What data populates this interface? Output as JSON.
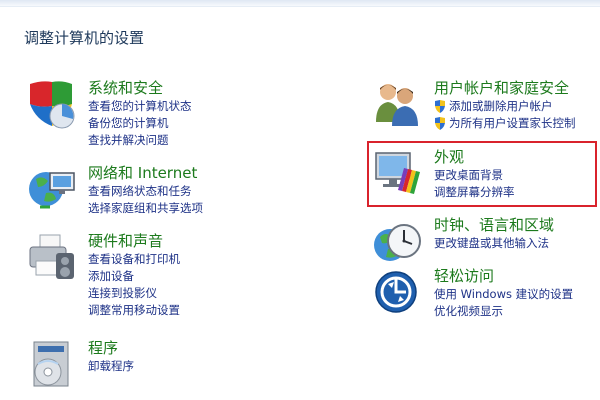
{
  "page": {
    "title": "调整计算机的设置"
  },
  "left": [
    {
      "title": "系统和安全",
      "icon": "shield-pie-icon",
      "links": [
        "查看您的计算机状态",
        "备份您的计算机",
        "查找并解决问题"
      ]
    },
    {
      "title": "网络和 Internet",
      "icon": "network-globe-icon",
      "links": [
        "查看网络状态和任务",
        "选择家庭组和共享选项"
      ]
    },
    {
      "title": "硬件和声音",
      "icon": "printer-icon",
      "links": [
        "查看设备和打印机",
        "添加设备",
        "连接到投影仪",
        "调整常用移动设置"
      ]
    },
    {
      "title": "程序",
      "icon": "programs-disc-icon",
      "links": [
        "卸载程序"
      ]
    }
  ],
  "right": [
    {
      "title": "用户帐户和家庭安全",
      "icon": "users-icon",
      "links": [
        "添加或删除用户帐户",
        "为所有用户设置家长控制"
      ],
      "link_icon": "uac-shield-icon"
    },
    {
      "title": "外观",
      "icon": "monitor-palette-icon",
      "links": [
        "更改桌面背景",
        "调整屏幕分辨率"
      ]
    },
    {
      "title": "时钟、语言和区域",
      "icon": "clock-globe-icon",
      "links": [
        "更改键盘或其他输入法"
      ]
    },
    {
      "title": "轻松访问",
      "icon": "ease-of-access-icon",
      "links": [
        "使用 Windows 建议的设置",
        "优化视频显示"
      ]
    }
  ],
  "colors": {
    "title_green": "#1c7a1c",
    "link_blue": "#1e3287",
    "highlight_red": "#d9232c"
  }
}
